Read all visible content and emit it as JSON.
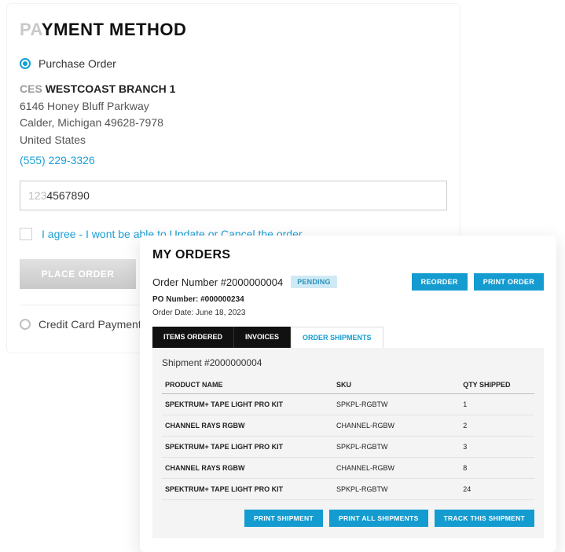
{
  "payment": {
    "title_fade": "PA",
    "title_rest": "YMENT METHOD",
    "option_po": "Purchase Order",
    "option_cc": "Credit Card Payment",
    "company_fade": "CES ",
    "company_bold": "WESTCOAST BRANCH 1",
    "addr1": "6146 Honey Bluff Parkway",
    "addr2": "Calder, Michigan 49628-7978",
    "country": "United States",
    "phone": "(555) 229-3326",
    "po_value_fade": "123",
    "po_value_rest": "4567890",
    "agree_text": "I agree - I wont be able to Update or Cancel the order",
    "place_order": "PLACE ORDER"
  },
  "orders": {
    "title": "MY ORDERS",
    "order_number_label": "Order Number #2000000004",
    "status": "PENDING",
    "reorder": "REORDER",
    "print_order": "PRINT ORDER",
    "po_line": "PO Number: #000000234",
    "date_line": "Order Date: June 18, 2023",
    "tabs": {
      "items": "ITEMS ORDERED",
      "invoices": "INVOICES",
      "shipments": "ORDER SHIPMENTS"
    },
    "shipment_title": "Shipment #2000000004",
    "columns": {
      "product": "PRODUCT NAME",
      "sku": "SKU",
      "qty": "QTY SHIPPED"
    },
    "rows": [
      {
        "name": "SPEKTRUM+ TAPE LIGHT PRO KIT",
        "sku": "SPKPL-RGBTW",
        "qty": "1"
      },
      {
        "name": "CHANNEL RAYS RGBW",
        "sku": "CHANNEL-RGBW",
        "qty": "2"
      },
      {
        "name": "SPEKTRUM+ TAPE LIGHT PRO KIT",
        "sku": "SPKPL-RGBTW",
        "qty": "3"
      },
      {
        "name": "CHANNEL RAYS RGBW",
        "sku": "CHANNEL-RGBW",
        "qty": "8"
      },
      {
        "name": "SPEKTRUM+ TAPE LIGHT PRO KIT",
        "sku": "SPKPL-RGBTW",
        "qty": "24"
      }
    ],
    "buttons": {
      "print_shipment": "PRINT SHIPMENT",
      "print_all": "PRINT ALL SHIPMENTS",
      "track": "TRACK THIS SHIPMENT"
    }
  }
}
